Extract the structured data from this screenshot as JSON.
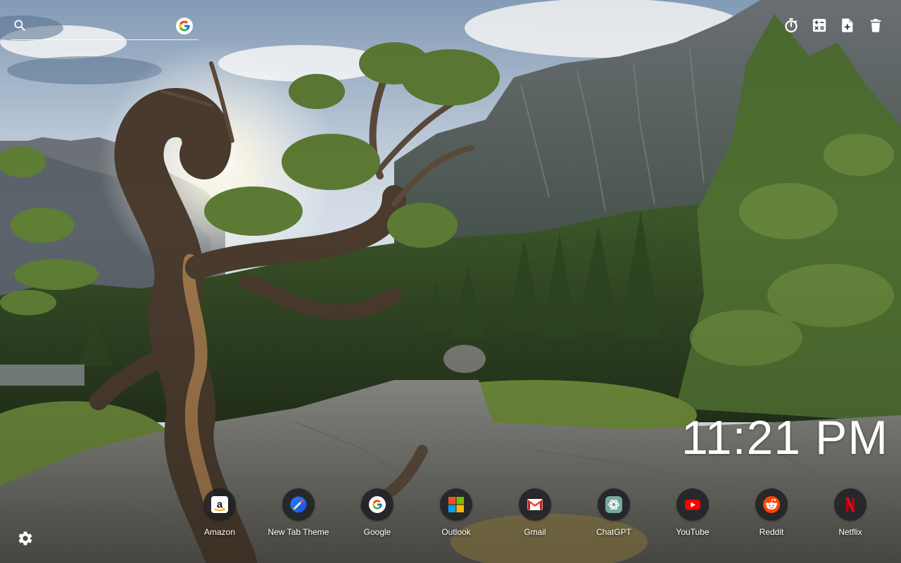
{
  "search": {
    "placeholder": ""
  },
  "toolbar": {
    "items": [
      {
        "icon": "timer-icon"
      },
      {
        "icon": "calculator-icon"
      },
      {
        "icon": "add-note-icon"
      },
      {
        "icon": "delete-icon"
      }
    ]
  },
  "clock": {
    "time": "11:21 PM"
  },
  "shortcuts": [
    {
      "label": "Amazon",
      "icon": "amazon-icon",
      "color": "#ffffff"
    },
    {
      "label": "New Tab Theme",
      "icon": "new-tab-theme-icon",
      "color": "#1a73e8"
    },
    {
      "label": "Google",
      "icon": "google-icon",
      "color": "#4285f4"
    },
    {
      "label": "Outlook",
      "icon": "microsoft-icon",
      "color": "#f25022"
    },
    {
      "label": "Gmail",
      "icon": "gmail-icon",
      "color": "#ea4335"
    },
    {
      "label": "ChatGPT",
      "icon": "chatgpt-icon",
      "color": "#74aa9c"
    },
    {
      "label": "YouTube",
      "icon": "youtube-icon",
      "color": "#ff0000"
    },
    {
      "label": "Reddit",
      "icon": "reddit-icon",
      "color": "#ff4500"
    },
    {
      "label": "Netflix",
      "icon": "netflix-icon",
      "color": "#e50914"
    }
  ],
  "settings": {
    "icon": "settings-gear-icon"
  },
  "colors": {
    "text": "#ffffff",
    "tile_background": "#202124"
  }
}
